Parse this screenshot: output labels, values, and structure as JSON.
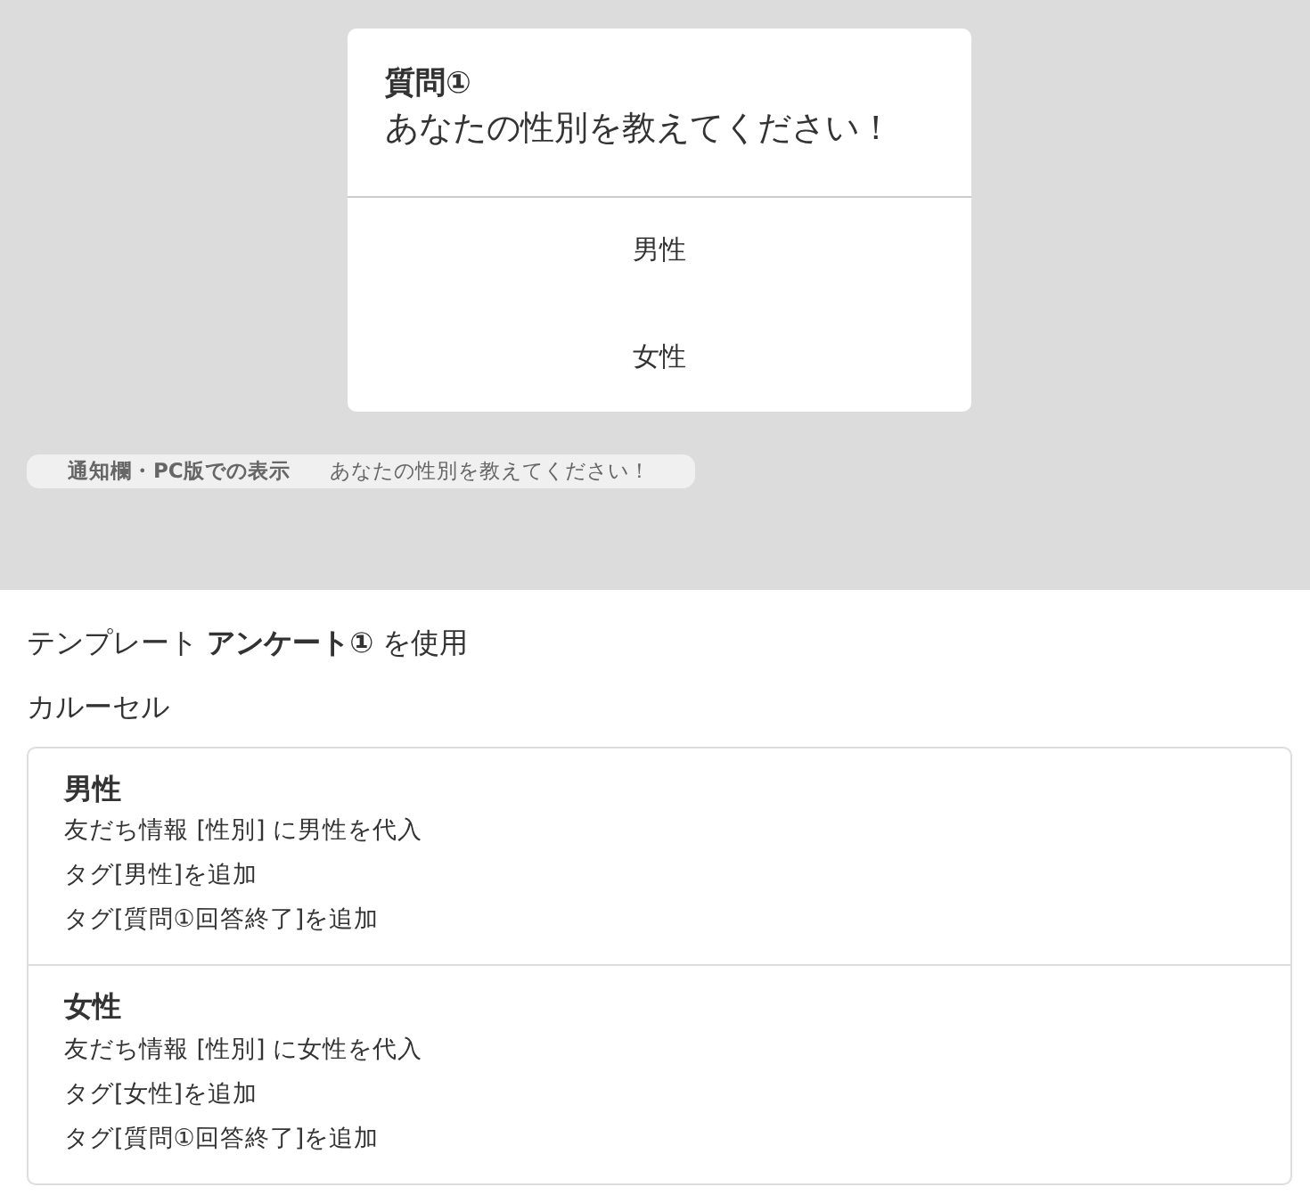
{
  "preview": {
    "card": {
      "title": "質問①",
      "question": "あなたの性別を教えてください！",
      "options": [
        "男性",
        "女性"
      ]
    },
    "notification": {
      "label": "通知欄・PC版での表示",
      "text": "あなたの性別を教えてください！"
    }
  },
  "template_line": "テンプレート **アンケート①** を使用",
  "type_label": "カルーセル",
  "actions": [
    {
      "title": "男性",
      "lines": [
        "友だち情報 [性別] に男性を代入",
        "タグ[男性]を追加",
        "タグ[質問①回答終了]を追加"
      ]
    },
    {
      "title": "女性",
      "lines": [
        "友だち情報 [性別] に女性を代入",
        "タグ[女性]を追加",
        "タグ[質問①回答終了]を追加"
      ]
    }
  ]
}
